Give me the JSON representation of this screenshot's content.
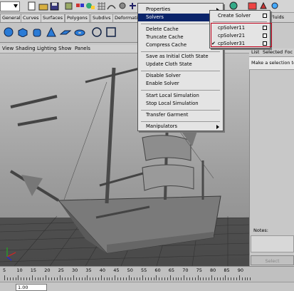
{
  "topbar": {
    "mode_value": ""
  },
  "shelf_tabs": [
    "General",
    "Curves",
    "Surfaces",
    "Polygons",
    "Subdivs",
    "Deformatio"
  ],
  "fluids_tab": "Fluids",
  "viewport_menu": [
    "View",
    "Shading",
    "Lighting",
    "Show",
    "Panels"
  ],
  "right_panel": {
    "menu": [
      "List",
      "Selected",
      "Foc"
    ],
    "help_text": "Make a selection to",
    "notes_label": "Notes:",
    "select_button": "Select"
  },
  "main_menu": {
    "items": [
      {
        "label": "Properties",
        "submenu": true
      },
      {
        "label": "Solvers",
        "submenu": true,
        "highlighted": true
      },
      {
        "label": "Delete Cache"
      },
      {
        "label": "Truncate Cache"
      },
      {
        "label": "Compress Cache"
      },
      {
        "label": "Save as Initial Cloth State"
      },
      {
        "label": "Update Cloth State"
      },
      {
        "label": "Disable Solver"
      },
      {
        "label": "Enable Solver"
      },
      {
        "label": "Start Local Simulation"
      },
      {
        "label": "Stop Local Simulation"
      },
      {
        "label": "Transfer Garment"
      },
      {
        "label": "Manipulators",
        "submenu": true
      }
    ]
  },
  "solvers_menu": {
    "create": "Create Solver",
    "solvers": [
      {
        "label": "cpSolver11",
        "checked": false
      },
      {
        "label": "cpSolver21",
        "checked": false
      },
      {
        "label": "cpSolver31",
        "checked": true
      }
    ]
  },
  "timeline": {
    "ticks": [
      "5",
      "10",
      "15",
      "20",
      "25",
      "30",
      "35",
      "40",
      "45",
      "50",
      "55",
      "60",
      "65",
      "70",
      "75",
      "80",
      "85",
      "90"
    ],
    "start_value": "1.00"
  },
  "colors": {
    "menu_highlight": "#0a246a",
    "annotation_box": "#c0001a"
  }
}
